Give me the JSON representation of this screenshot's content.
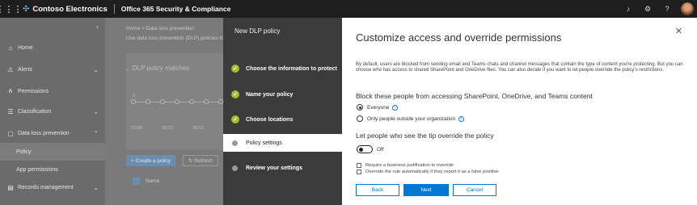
{
  "topbar": {
    "brand": "Contoso Electronics",
    "app_title": "Office 365 Security & Compliance",
    "icons": [
      "bell-icon",
      "gear-icon",
      "help-icon",
      "avatar"
    ]
  },
  "leftnav": {
    "items": [
      {
        "label": "Home",
        "icon": "home-icon"
      },
      {
        "label": "Alerts",
        "icon": "alert-icon"
      },
      {
        "label": "Permissions",
        "icon": "people-icon"
      },
      {
        "label": "Classification",
        "icon": "list-icon"
      },
      {
        "label": "Data loss prevention",
        "icon": "document-icon"
      },
      {
        "label": "Records management",
        "icon": "records-icon"
      }
    ],
    "subitems": [
      {
        "label": "Policy"
      },
      {
        "label": "App permissions"
      }
    ]
  },
  "background": {
    "breadcrumb": "Home > Data loss prevention",
    "description": "Use data loss prevention (DLP) policies to",
    "card_title": "DLP policy matches",
    "zero": "0",
    "dates": [
      "05/08",
      "05/10",
      "05/12"
    ],
    "create_button": "+ Create a policy",
    "refresh_button": "Refresh",
    "column_name": "Name"
  },
  "wizard": {
    "title": "New DLP policy",
    "steps": [
      {
        "label": "Choose the information to protect",
        "state": "done"
      },
      {
        "label": "Name your policy",
        "state": "done"
      },
      {
        "label": "Choose locations",
        "state": "done"
      },
      {
        "label": "Policy settings",
        "state": "active"
      },
      {
        "label": "Review your settings",
        "state": "pending"
      }
    ]
  },
  "content": {
    "title": "Customize access and override permissions",
    "description": "By default, users are blocked from sending email and Teams chats and channel messages that contain the type of content you're protecting. But you can choose who has access to shared SharePoint and OneDrive files. You can also decide if you want to let people override the policy's restrictions.",
    "block_heading": "Block these people from accessing SharePoint, OneDrive, and Teams content",
    "radio_everyone": "Everyone",
    "radio_outside": "Only people outside your organization",
    "override_heading": "Let people who see the tip override the policy",
    "toggle_label": "Off",
    "check_justification": "Require a business justification to override",
    "check_false_positive": "Override the rule automatically if they report it as a false positive",
    "back": "Back",
    "next": "Next",
    "cancel": "Cancel"
  },
  "colors": {
    "accent": "#0078d4",
    "step_done": "#9ec232",
    "topbar": "#1e1e1e",
    "wizard_panel": "#3b3b3b"
  }
}
